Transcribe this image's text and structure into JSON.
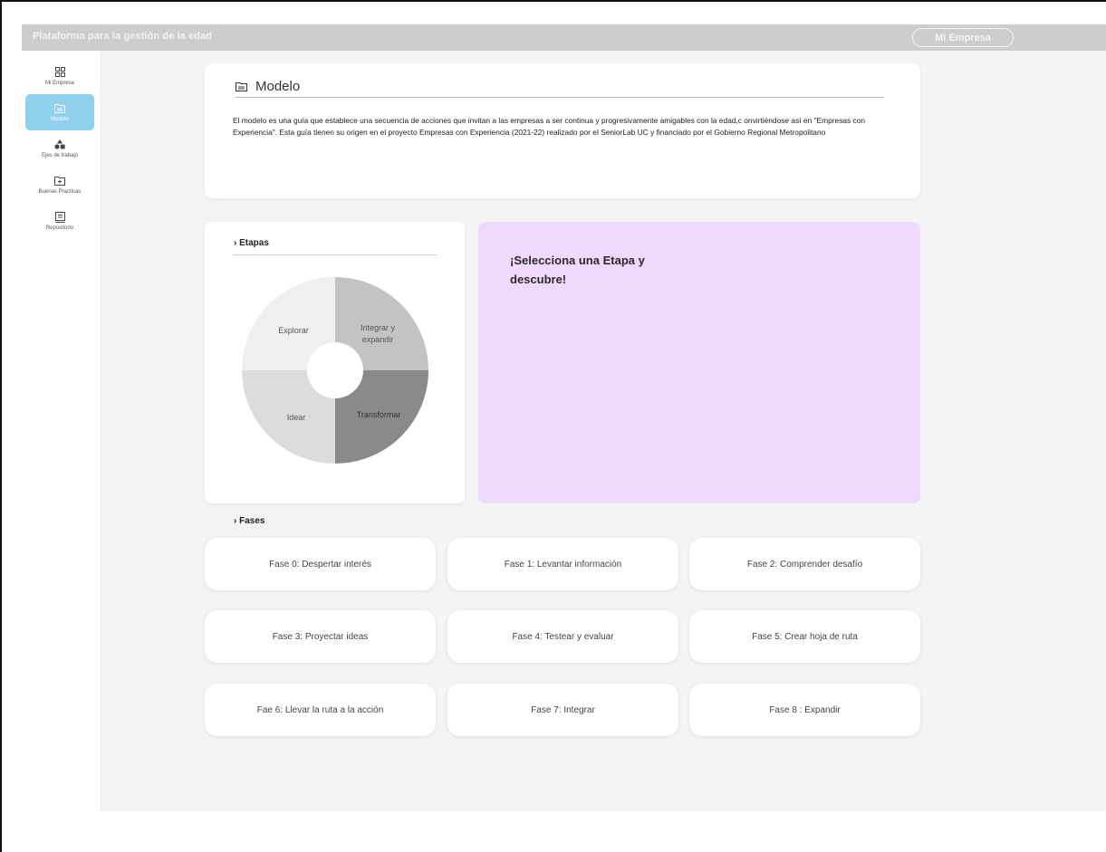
{
  "header": {
    "app_title": "Plataforma para la gestión de la edad",
    "company_button": "Mi Empresa"
  },
  "sidebar": {
    "items": [
      {
        "label": "Mi Empresa",
        "icon": "dashboard-icon",
        "active": false
      },
      {
        "label": "Modelo",
        "icon": "folder-icon",
        "active": true
      },
      {
        "label": "Ejes de trabajo",
        "icon": "shapes-icon",
        "active": false
      },
      {
        "label": "Buenas Practicas",
        "icon": "folder-plus-icon",
        "active": false
      },
      {
        "label": "Repositorio",
        "icon": "archive-icon",
        "active": false
      }
    ]
  },
  "model": {
    "title": "Modelo",
    "description": "El modelo es una guía que establece una secuencia de acciones que invitan a las empresas a ser continua y progresivamente amigables con la edad,c onvirtiéndose así en \"Empresas con Experiencia\". Esta guía tienen su origen en el proyecto Empresas con Experiencia (2021-22) realizado por el SeniorLab UC y financiado por el Gobierno Regional Metropolitano"
  },
  "stages": {
    "heading": "› Etapas",
    "segments": [
      {
        "label": "Explorar",
        "color": "#efefef"
      },
      {
        "label": "Integrar y expandir",
        "color": "#c3c3c3"
      },
      {
        "label": "Transformar",
        "color": "#8a8a8a"
      },
      {
        "label": "Idear",
        "color": "#dcdcdc"
      }
    ]
  },
  "select_prompt": "¡Selecciona una Etapa y descubre!",
  "phases": {
    "heading": "› Fases",
    "items": [
      "Fase 0: Despertar interés",
      "Fase 1: Levantar información",
      "Fase 2: Comprender desafío",
      "Fase 3: Proyectar ideas",
      "Fase 4: Testear y evaluar",
      "Fase 5: Crear hoja de ruta",
      "Fae 6: Llevar la ruta a la acción",
      "Fase 7: Integrar",
      "Fase 8 : Expandir"
    ]
  }
}
